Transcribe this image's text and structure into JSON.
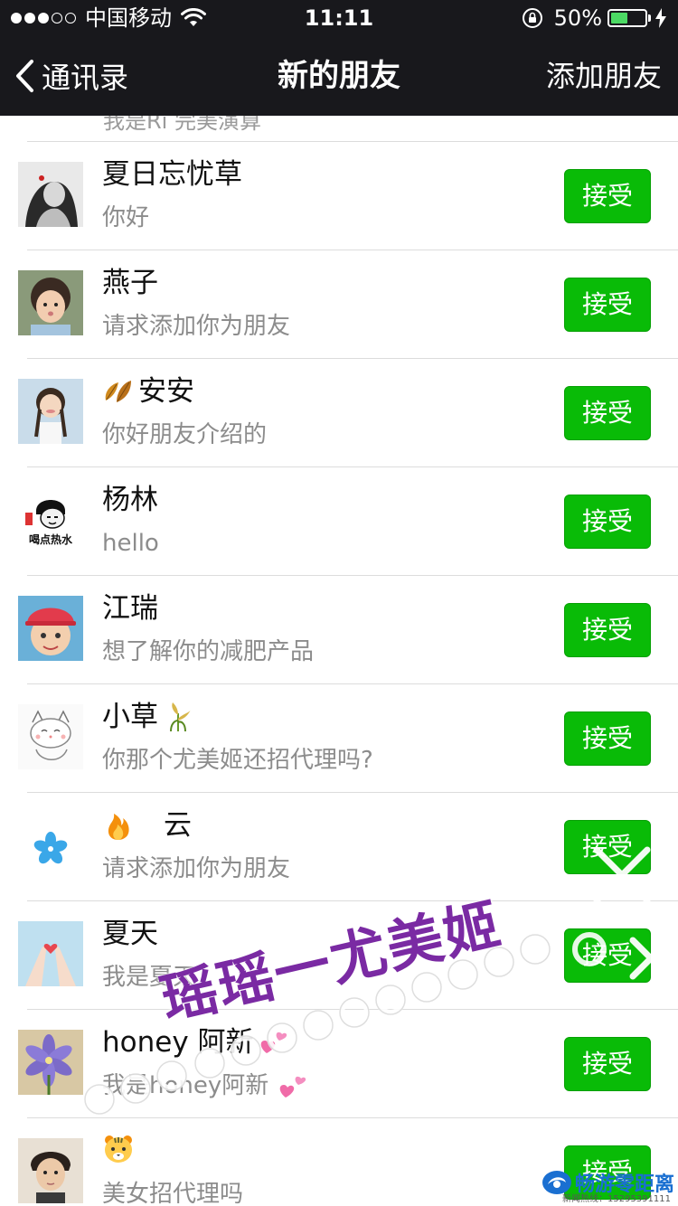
{
  "status_bar": {
    "carrier": "中国移动",
    "time": "11:11",
    "battery_percent": "50%",
    "battery_level": 0.5,
    "signal_bars_filled": 3,
    "signal_bars_total": 5
  },
  "nav": {
    "back_label": "通讯录",
    "title": "新的朋友",
    "right_action": "添加朋友"
  },
  "list": {
    "partial_top_text": "我是Ri 完美演算",
    "accept_label": "接受",
    "items": [
      {
        "name": "夏日忘忧草",
        "message": "你好",
        "avatar": "portrait-avatar"
      },
      {
        "name": "燕子",
        "message": "请求添加你为朋友",
        "avatar": "child-avatar"
      },
      {
        "name": "安安",
        "name_emoji": "fallen-leaves-emoji",
        "message": "你好朋友介绍的",
        "avatar": "girl-braids-avatar"
      },
      {
        "name": "杨林",
        "message": "hello",
        "avatar": "cartoon-meme-avatar",
        "avatar_caption": "喝点热水"
      },
      {
        "name": "江瑞",
        "message": "想了解你的减肥产品",
        "avatar": "boy-red-cap-avatar"
      },
      {
        "name": "小草",
        "name_emoji": "rice-stalk-emoji",
        "message": "你那个尤美姬还招代理吗?",
        "avatar": "cartoon-cat-avatar"
      },
      {
        "name": "云",
        "name_emoji_before": "fire-emoji",
        "message": "请求添加你为朋友",
        "avatar": "blue-flower-avatar"
      },
      {
        "name": "夏天",
        "message": "我是夏天",
        "avatar": "hands-heart-avatar"
      },
      {
        "name": "honey 阿新",
        "name_emoji": "two-hearts-emoji",
        "message": "我是honey阿新",
        "message_emoji": "two-hearts-emoji",
        "avatar": "purple-flower-avatar"
      },
      {
        "name": "",
        "name_emoji_before": "tiger-face-emoji",
        "message": "美女招代理吗",
        "avatar": "young-man-avatar"
      }
    ]
  },
  "watermark": {
    "text": "瑶瑶一尤美姬",
    "brand": "畅游零距离",
    "hotline": "新闻热线：15295391111"
  },
  "colors": {
    "bar_background": "#18181c",
    "accept_green": "#09bb07",
    "battery_green": "#4cd964",
    "watermark_purple": "#7a2aa3"
  }
}
